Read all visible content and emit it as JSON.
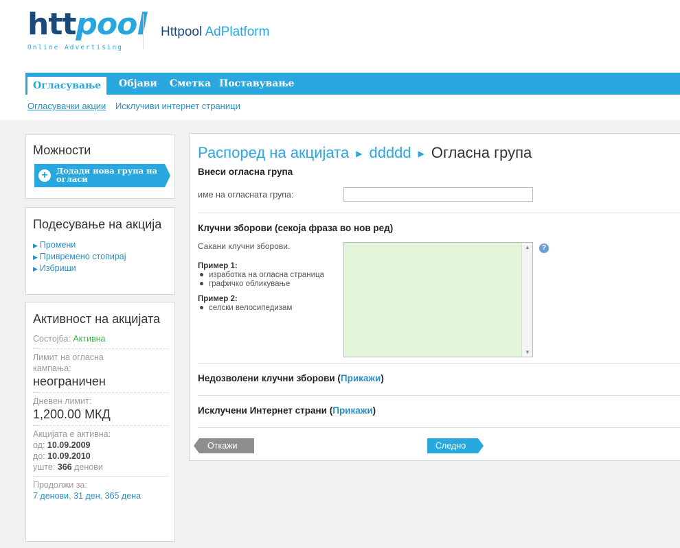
{
  "header": {
    "logo_http": "htt",
    "logo_oo": "pool",
    "logo_tag": "Online Advertising",
    "platform_prefix": "Httpool ",
    "platform_suffix": "AdPlatform"
  },
  "nav": {
    "items": [
      "Огласување",
      "Објави",
      "Сметка",
      "Поставување"
    ],
    "active": "Огласување"
  },
  "subnav": {
    "items": [
      "Огласувачки акции",
      "Исклучиви интернет страници"
    ],
    "active": "Огласувачки акции"
  },
  "options": {
    "title": "Можности",
    "add_button": "Додади нова група на огласи"
  },
  "campaign_settings": {
    "title": "Подесување на акција",
    "links": [
      "Промени",
      "Привремено стопирај",
      "Избриши"
    ]
  },
  "activity": {
    "title": "Активност на акцијата",
    "status_label": "Состојба: ",
    "status_value": "Активна",
    "limit_label": "Лимит на огласна кампања:",
    "limit_value": "неограничен",
    "daily_label": "Дневен лимит:",
    "daily_value": "1,200.00 МКД",
    "active_label": "Акцијата е активна:",
    "from_label": "од: ",
    "from_value": "10.09.2009",
    "to_label": "до: ",
    "to_value": "10.09.2010",
    "left_label": "уште: ",
    "left_value": "366",
    "left_suffix": " денови",
    "extend_label": "Продолжи за:",
    "extend_options": [
      "7 денови",
      "31 ден",
      "365 дена"
    ]
  },
  "main": {
    "breadcrumb": [
      "Распоред на акцијата",
      "ddddd",
      "Огласна група"
    ],
    "section_enter": "Внеси огласна група",
    "name_label": "име на огласната група:",
    "name_value": "",
    "keywords_title": "Клучни зборови (секоја фраза во нов ред)",
    "keywords_hint": "Сакани клучни зборови.",
    "example1_title": "Пример 1:",
    "example1_items": [
      "изработка на огласна страница",
      "графичко обликување"
    ],
    "example2_title": "Пример 2:",
    "example2_items": [
      "селски велосипедизам"
    ],
    "keywords_value": "",
    "negative_title": "Недозволени клучни зборови (",
    "negative_link": "Прикажи",
    "excluded_title": "Исклучени Интернет страни (",
    "excluded_link": "Прикажи",
    "close_paren": ")",
    "cancel_label": "Откажи",
    "next_label": "Следно"
  },
  "colors": {
    "accent": "#29a7df",
    "logo_dark": "#1a4a7a",
    "status_green": "#3ab54a",
    "keyword_bg": "#e3f5d9",
    "cancel_gray": "#8e8e8e"
  }
}
